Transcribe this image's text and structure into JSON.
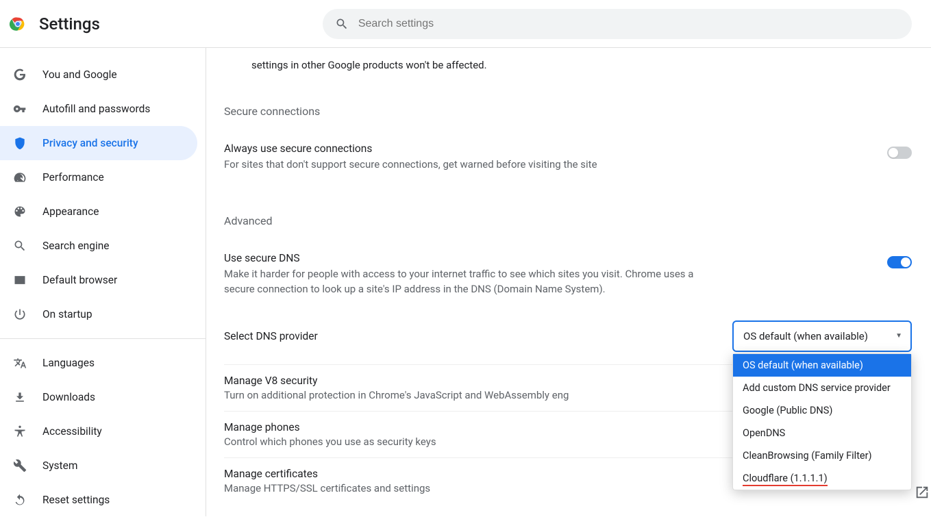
{
  "header": {
    "title": "Settings",
    "search_placeholder": "Search settings"
  },
  "sidebar": {
    "group1": [
      {
        "icon": "google",
        "label": "You and Google"
      },
      {
        "icon": "key",
        "label": "Autofill and passwords"
      },
      {
        "icon": "shield",
        "label": "Privacy and security",
        "active": true
      },
      {
        "icon": "speed",
        "label": "Performance"
      },
      {
        "icon": "palette",
        "label": "Appearance"
      },
      {
        "icon": "search",
        "label": "Search engine"
      },
      {
        "icon": "browser",
        "label": "Default browser"
      },
      {
        "icon": "power",
        "label": "On startup"
      }
    ],
    "group2": [
      {
        "icon": "translate",
        "label": "Languages"
      },
      {
        "icon": "download",
        "label": "Downloads"
      },
      {
        "icon": "accessibility",
        "label": "Accessibility"
      },
      {
        "icon": "system",
        "label": "System"
      },
      {
        "icon": "reset",
        "label": "Reset settings"
      }
    ]
  },
  "main": {
    "top_note": "settings in other Google products won't be affected.",
    "secure_header": "Secure connections",
    "secure_row": {
      "title": "Always use secure connections",
      "desc": "For sites that don't support secure connections, get warned before visiting the site",
      "on": false
    },
    "advanced_header": "Advanced",
    "dns_row": {
      "title": "Use secure DNS",
      "desc": "Make it harder for people with access to your internet traffic to see which sites you visit. Chrome uses a secure connection to look up a site's IP address in the DNS (Domain Name System).",
      "on": true
    },
    "dns_select": {
      "label": "Select DNS provider",
      "value": "OS default (when available)",
      "options": [
        "OS default (when available)",
        "Add custom DNS service provider",
        "Google (Public DNS)",
        "OpenDNS",
        "CleanBrowsing (Family Filter)",
        "Cloudflare (1.1.1.1)"
      ]
    },
    "v8": {
      "title": "Manage V8 security",
      "desc": "Turn on additional protection in Chrome's JavaScript and WebAssembly eng"
    },
    "phones": {
      "title": "Manage phones",
      "desc": "Control which phones you use as security keys"
    },
    "certs": {
      "title": "Manage certificates",
      "desc": "Manage HTTPS/SSL certificates and settings"
    }
  }
}
